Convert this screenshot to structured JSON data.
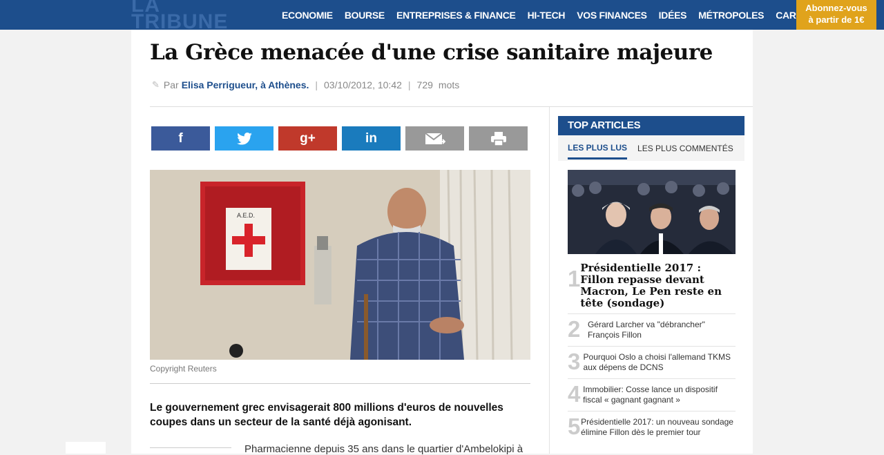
{
  "header": {
    "logo": "LA TRIBUNE",
    "nav": [
      "ECONOMIE",
      "BOURSE",
      "ENTREPRISES & FINANCE",
      "HI-TECH",
      "VOS FINANCES",
      "IDÉES",
      "MÉTROPOLES",
      "CARRIÈRES"
    ],
    "subscribe_line1": "Abonnez-vous",
    "subscribe_line2": "à partir de 1€"
  },
  "article": {
    "title": "La Grèce menacée d'une crise sanitaire majeure",
    "by": "Par",
    "author": "Elisa Perrigueur, à Athènes.",
    "date": "03/10/2012, 10:42",
    "word_count": "729",
    "words_label": "mots",
    "share": {
      "facebook": "f",
      "google": "g+",
      "linkedin": "in"
    },
    "photo_text": "A.E.D.",
    "caption": "Copyright Reuters",
    "lead": "Le gouvernement grec envisagerait 800 millions d'euros de nouvelles coupes dans un secteur de la santé déjà agonisant.",
    "body_start": "Pharmacienne depuis 35 ans dans le quartier d'Ambelokipi à"
  },
  "sidebar": {
    "heading": "TOP ARTICLES",
    "tabs": [
      "LES PLUS LUS",
      "LES PLUS COMMENTÉS"
    ],
    "items": [
      {
        "num": "1",
        "text": "Présidentielle 2017 : Fillon repasse devant Macron, Le Pen reste en tête (sondage)"
      },
      {
        "num": "2",
        "text": "Gérard Larcher va \"débrancher\" François Fillon"
      },
      {
        "num": "3",
        "text": "Pourquoi Oslo a choisi l'allemand TKMS aux dépens de DCNS"
      },
      {
        "num": "4",
        "text": "Immobilier: Cosse lance un dispositif fiscal « gagnant gagnant »"
      },
      {
        "num": "5",
        "text": "Présidentielle 2017: un nouveau sondage élimine Fillon dès le premier tour"
      }
    ]
  },
  "colors": {
    "brand": "#1d4e8c",
    "subscribe": "#e0a31c"
  }
}
